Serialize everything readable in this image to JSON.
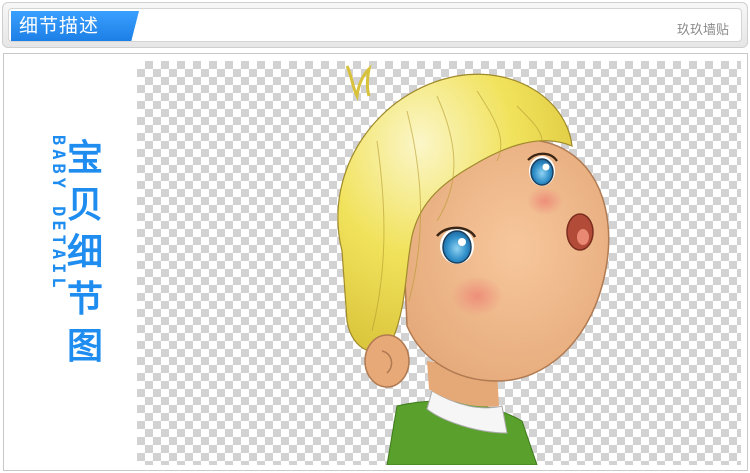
{
  "header": {
    "title": "细节描述",
    "shop_name": "玖玖墙贴"
  },
  "side_caption": {
    "english": "BABY DETAIL",
    "chinese": [
      "宝",
      "贝",
      "细",
      "节",
      "图"
    ]
  },
  "colors": {
    "accent": "#1f8df0",
    "hair": "#f2e35a",
    "skin": "#f0b98a",
    "shirt": "#5aa02c"
  },
  "illustration": {
    "subject": "cartoon-boy-looking-up"
  }
}
